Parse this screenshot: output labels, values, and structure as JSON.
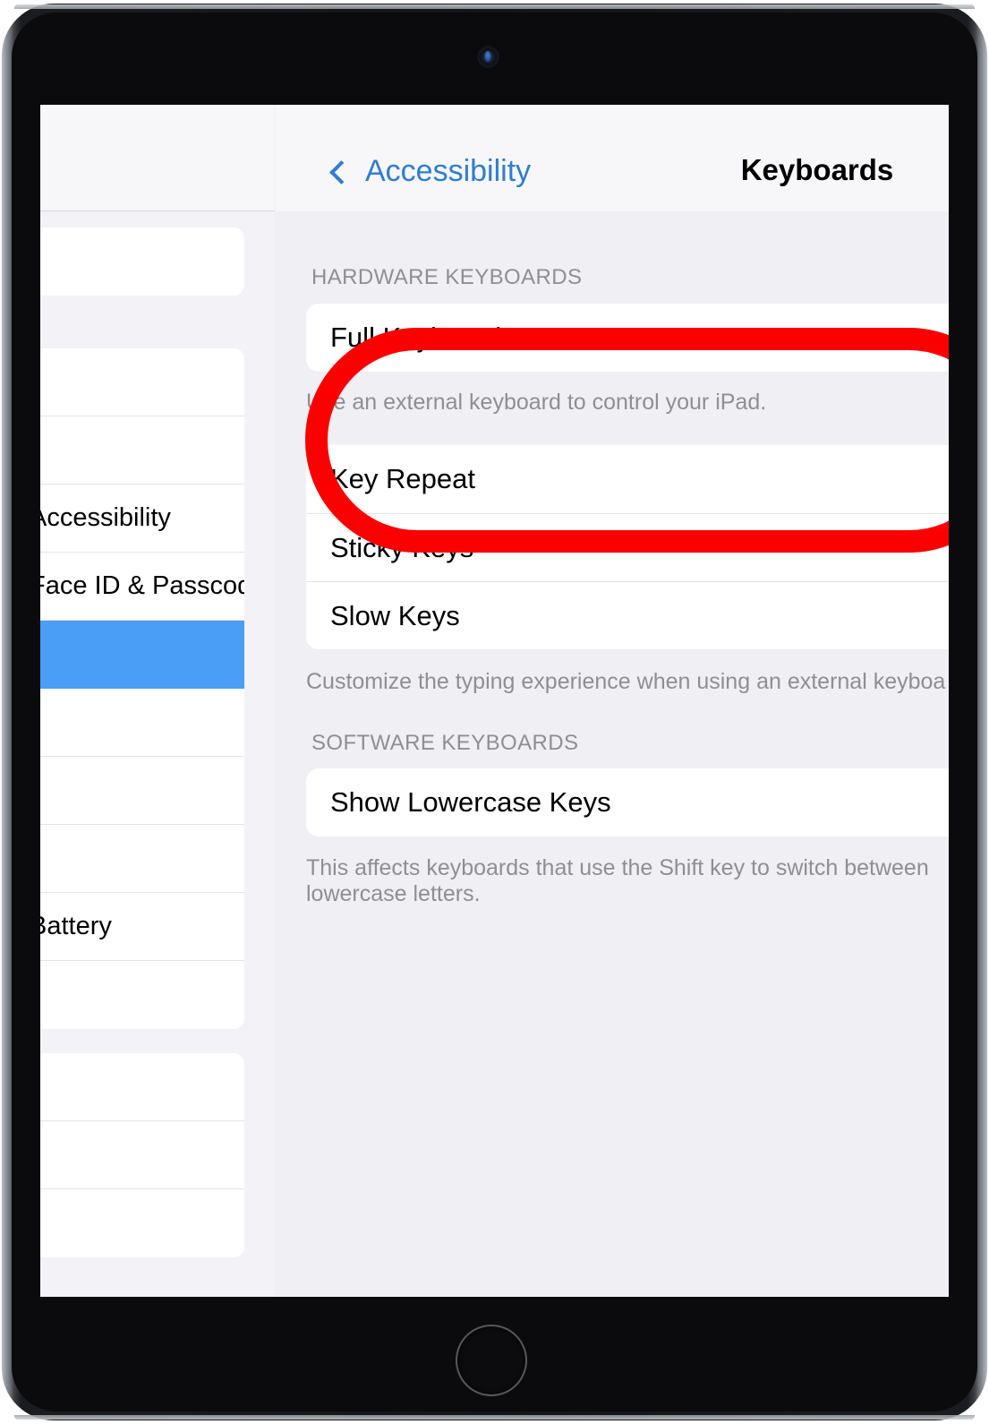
{
  "device": {
    "name": "iPad",
    "camera_icon": "front-camera",
    "home_button_label": "Home"
  },
  "sidebar": {
    "rows": [
      {
        "label": "",
        "selected": false
      },
      {
        "label": "",
        "selected": false
      },
      {
        "label": "",
        "selected": false
      },
      {
        "label": "Accessibility",
        "selected": false
      },
      {
        "label": "Face ID & Passcode",
        "selected": false
      },
      {
        "label": "",
        "selected": true
      },
      {
        "label": "",
        "selected": false
      },
      {
        "label": "",
        "selected": false
      },
      {
        "label": "",
        "selected": false
      },
      {
        "label": "Battery",
        "selected": false
      },
      {
        "label": "",
        "selected": false
      },
      {
        "label": "",
        "selected": false
      },
      {
        "label": "",
        "selected": false
      },
      {
        "label": "",
        "selected": false
      }
    ]
  },
  "nav": {
    "back_label": "Accessibility",
    "back_icon": "chevron-left-icon",
    "title": "Keyboards"
  },
  "sections": [
    {
      "header": "HARDWARE KEYBOARDS",
      "rows": [
        "Full Keyboard Access"
      ],
      "footnote": "Use an external keyboard to control your iPad."
    },
    {
      "header": "",
      "rows": [
        "Key Repeat",
        "Sticky Keys",
        "Slow Keys"
      ],
      "footnote": "Customize the typing experience when using an external keyboa"
    },
    {
      "header": "SOFTWARE KEYBOARDS",
      "rows": [
        "Show Lowercase Keys"
      ],
      "footnote": "This affects keyboards that use the Shift key to switch between  lowercase letters."
    }
  ],
  "annotation": {
    "type": "red-rounded-rect-highlight",
    "target": "Full Keyboard Access",
    "color": "#fa0000"
  },
  "colors": {
    "accent_blue": "#2f7dd1",
    "selected_row_blue": "#4a9ef5",
    "annotation_red": "#fa0000",
    "screen_background": "#efeff4",
    "card_background": "#ffffff",
    "secondary_text": "#8e8e93"
  }
}
